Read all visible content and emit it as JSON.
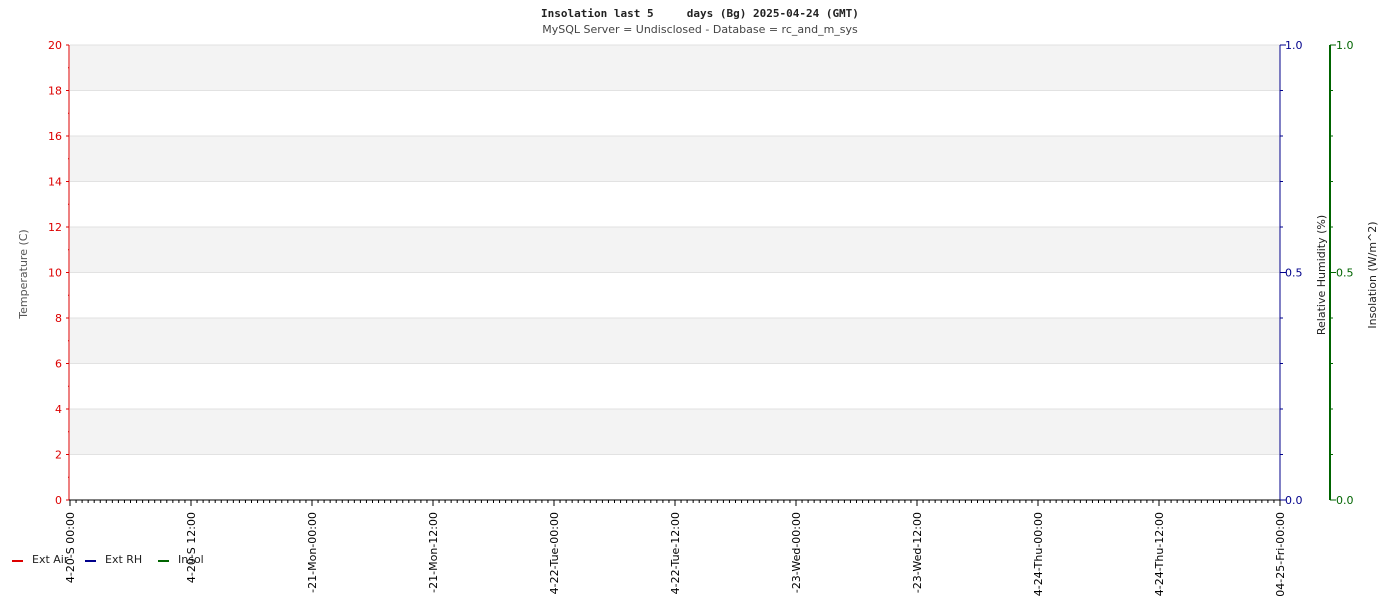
{
  "chart_data": {
    "type": "line",
    "title": "Insolation last 5     days (Bg) 2025-04-24 (GMT)",
    "subtitle": "MySQL Server = Undisclosed - Database = rc_and_m_sys",
    "x_ticks": [
      "2025-04-20-Sun-00:00",
      "2025-04-20-Sun-12:00",
      "2025-04-21-Mon-00:00",
      "2025-04-21-Mon-12:00",
      "2025-04-22-Tue-00:00",
      "2025-04-22-Tue-12:00",
      "2025-04-23-Wed-00:00",
      "2025-04-23-Wed-12:00",
      "2025-04-24-Thu-00:00",
      "2025-04-24-Thu-12:00",
      "2025-04-25-Fri-00:00"
    ],
    "x_tick_labels": [
      "4-20-S 00:00",
      "4-20-S 12:00",
      "-21-Mon-00:00",
      "-21-Mon-12:00",
      "4-22-Tue-00:00",
      "4-22-Tue-12:00",
      "-23-Wed-00:00",
      "-23-Wed-12:00",
      "4-24-Thu-00:00",
      "4-24-Thu-12:00",
      "04-25-Fri-00:00"
    ],
    "axes": {
      "temperature": {
        "label": "Temperature (C)",
        "ylim": [
          0,
          20
        ],
        "ticks": [
          0,
          2,
          4,
          6,
          8,
          10,
          12,
          14,
          16,
          18,
          20
        ],
        "color": "#dd0000"
      },
      "humidity": {
        "label": "Relative Humidity (%)",
        "ylim": [
          0.0,
          1.0
        ],
        "ticks": [
          "0.0",
          "0.5",
          "1.0"
        ],
        "color": "#00008b"
      },
      "insolation": {
        "label": "Insolation (W/m^2)",
        "ylim": [
          0.0,
          1.0
        ],
        "ticks": [
          "0.0",
          "0.5",
          "1.0"
        ],
        "color": "#006400"
      }
    },
    "series": [
      {
        "name": "Ext Air",
        "color": "#dd0000",
        "values": []
      },
      {
        "name": "Ext RH",
        "color": "#00008b",
        "values": []
      },
      {
        "name": "Insol",
        "color": "#006400",
        "values": []
      }
    ],
    "grid": true,
    "legend_position": "bottom-left"
  }
}
